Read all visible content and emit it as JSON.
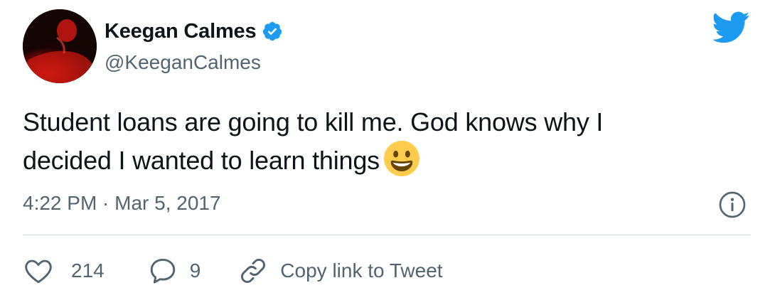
{
  "author": {
    "display_name": "Keegan Calmes",
    "handle": "@KeeganCalmes",
    "verified": true
  },
  "tweet": {
    "text_line1": "Student loans are going to kill me. God knows why I",
    "text_line2": "decided I wanted to learn things",
    "emoji": "grinning-face",
    "timestamp": "4:22 PM · Mar 5, 2017"
  },
  "actions": {
    "like_count": "214",
    "reply_count": "9",
    "copy_link_label": "Copy link to Tweet"
  },
  "icons": [
    "verified-badge-icon",
    "twitter-bird-icon",
    "info-icon",
    "heart-icon",
    "reply-bubble-icon",
    "link-icon"
  ],
  "colors": {
    "brand_blue": "#1d9bf0",
    "text_primary": "#0f1419",
    "text_secondary": "#536471",
    "divider": "#cfd9de"
  }
}
